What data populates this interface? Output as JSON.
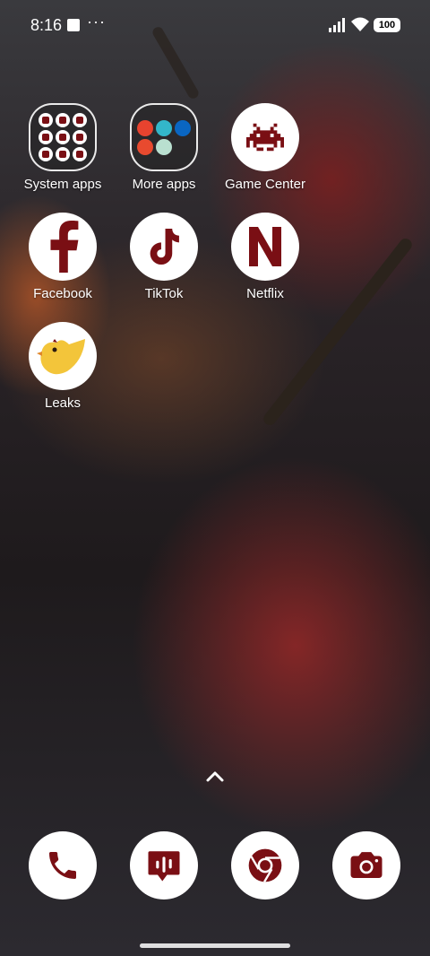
{
  "status_bar": {
    "time": "8:16",
    "more": "···",
    "battery": "100",
    "icons": [
      "notification-square-icon",
      "more-dots-icon",
      "signal-icon",
      "wifi-icon",
      "battery-icon"
    ]
  },
  "apps": [
    {
      "label": "System apps",
      "type": "folder",
      "icon": "folder-icon"
    },
    {
      "label": "More apps",
      "type": "folder",
      "icon": "folder-icon"
    },
    {
      "label": "Game Center",
      "icon": "space-invader-icon"
    },
    {
      "label": "Facebook",
      "icon": "facebook-icon"
    },
    {
      "label": "TikTok",
      "icon": "music-note-icon"
    },
    {
      "label": "Netflix",
      "icon": "netflix-icon"
    },
    {
      "label": "Leaks",
      "icon": "yellow-bird-icon"
    }
  ],
  "dock": [
    {
      "name": "Phone",
      "icon": "phone-icon"
    },
    {
      "name": "Messages",
      "icon": "message-icon"
    },
    {
      "name": "Chrome",
      "icon": "chrome-icon"
    },
    {
      "name": "Camera",
      "icon": "camera-icon"
    }
  ],
  "colors": {
    "icon_accent": "#7a0f14",
    "icon_background": "#ffffff",
    "label_text": "#ffffff"
  }
}
